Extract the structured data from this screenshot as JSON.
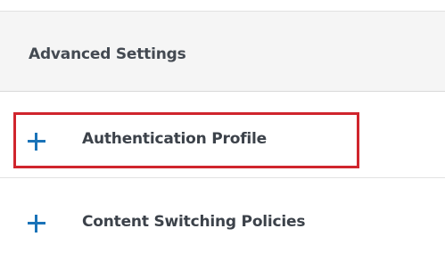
{
  "section": {
    "title": "Advanced Settings",
    "items": [
      {
        "label": "Authentication Profile",
        "icon": "plus-icon",
        "highlighted": true
      },
      {
        "label": "Content Switching Policies",
        "icon": "plus-icon",
        "highlighted": false
      }
    ]
  },
  "colors": {
    "accent": "#1a73b8",
    "highlight": "#d0252d",
    "header_bg": "#f5f5f5",
    "text": "#3c424a"
  }
}
